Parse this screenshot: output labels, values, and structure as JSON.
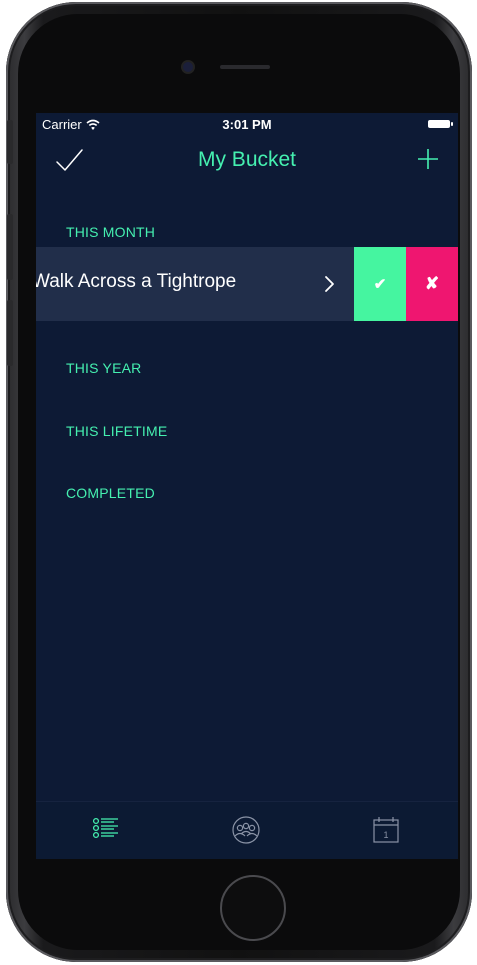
{
  "status_bar": {
    "carrier": "Carrier",
    "time": "3:01 PM"
  },
  "nav": {
    "title": "My Bucket",
    "left_icon": "checkmark-icon",
    "right_icon": "plus-icon"
  },
  "sections": [
    {
      "label": "THIS MONTH"
    },
    {
      "label": "THIS YEAR"
    },
    {
      "label": "THIS LIFETIME"
    },
    {
      "label": "COMPLETED"
    }
  ],
  "items": [
    {
      "label": "Walk Across a Tightrope",
      "complete_glyph": "✔",
      "delete_glyph": "✘"
    }
  ],
  "tabs": [
    {
      "icon": "list-icon",
      "active": true
    },
    {
      "icon": "friends-icon",
      "active": false
    },
    {
      "icon": "calendar-icon",
      "active": false,
      "calendar_day": "1"
    }
  ],
  "colors": {
    "accent": "#45f0b0",
    "background": "#0d1a35",
    "row_background": "#212e4a",
    "complete": "#45f5a0",
    "delete": "#ef1670"
  }
}
